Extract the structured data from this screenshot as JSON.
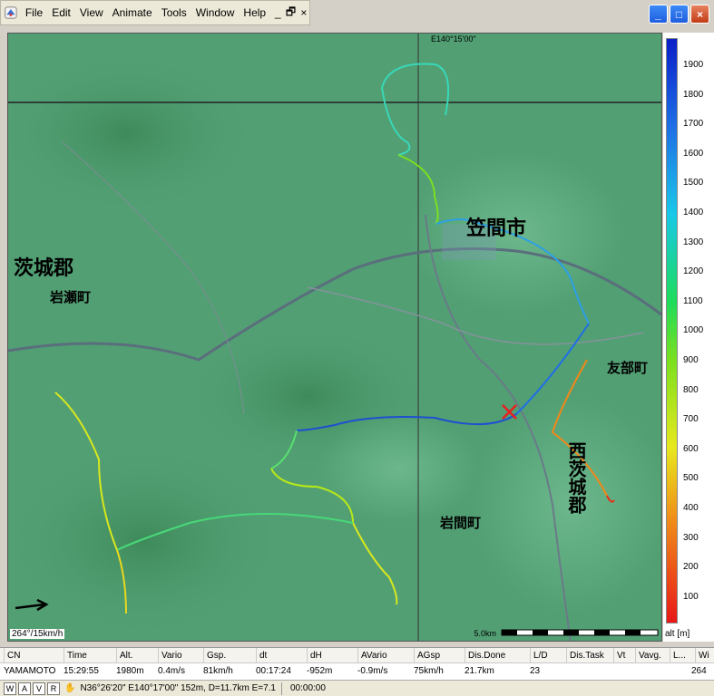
{
  "menubar": {
    "items": [
      "File",
      "Edit",
      "View",
      "Animate",
      "Tools",
      "Window",
      "Help"
    ],
    "mdi_controls": [
      "_",
      "🗗",
      "×"
    ]
  },
  "window_buttons": [
    "_",
    "□",
    "×"
  ],
  "map": {
    "coord_label": "E140°15'00\"",
    "wind_label": "264°/15km/h",
    "scale_label": "5.0km",
    "place_labels": [
      "笠間市",
      "茨城郡",
      "岩瀬町",
      "友部町",
      "岩間町",
      "西茨城郡"
    ],
    "track_color_note": "altitude-colored"
  },
  "alt_scale": {
    "ticks": [
      "1900",
      "1800",
      "1700",
      "1600",
      "1500",
      "1400",
      "1300",
      "1200",
      "1100",
      "1000",
      "900",
      "800",
      "700",
      "600",
      "500",
      "400",
      "300",
      "200",
      "100"
    ],
    "unit": "alt [m]"
  },
  "stats": {
    "headers": [
      "CN",
      "Time",
      "Alt.",
      "Vario",
      "Gsp.",
      "dt",
      "dH",
      "AVario",
      "AGsp",
      "Dis.Done",
      "L/D",
      "Dis.Task",
      "Vt",
      "Vavg.",
      "L...",
      "Wi"
    ],
    "values": [
      "YAMAMOTO",
      "15:29:55",
      "1980m",
      "0.4m/s",
      "81km/h",
      "00:17:24",
      "-952m",
      "-0.9m/s",
      "75km/h",
      "21.7km",
      "23",
      "",
      "",
      "",
      "",
      "264"
    ]
  },
  "statusbar": {
    "buttons": [
      "W",
      "A",
      "V",
      "R"
    ],
    "position": "N36°26'20\"  E140°17'00\" 152m, D=11.7km E=7.1",
    "time": "00:00:00"
  }
}
